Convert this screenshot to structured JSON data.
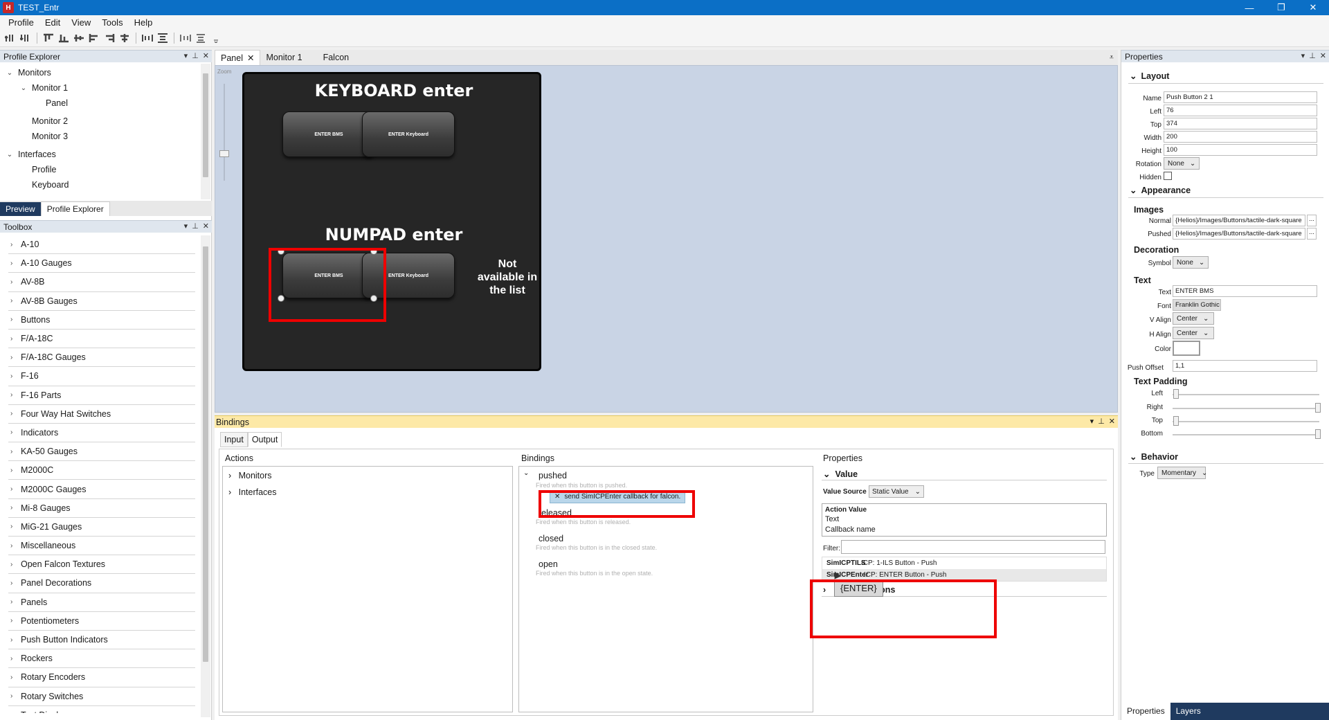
{
  "window": {
    "title": "TEST_Entr",
    "minimize": "—",
    "restore": "❐",
    "close": "✕"
  },
  "menu": [
    "Profile",
    "Edit",
    "View",
    "Tools",
    "Help"
  ],
  "profile_explorer": {
    "title": "Profile Explorer",
    "tree": [
      {
        "label": "Monitors",
        "level": 0,
        "expanded": true
      },
      {
        "label": "Monitor 1",
        "level": 1,
        "expanded": true
      },
      {
        "label": "Panel",
        "level": 2
      },
      {
        "label": "Monitor 2",
        "level": 1
      },
      {
        "label": "Monitor 3",
        "level": 1
      },
      {
        "label": "Interfaces",
        "level": 0,
        "expanded": true
      },
      {
        "label": "Profile",
        "level": 1
      },
      {
        "label": "Keyboard",
        "level": 1
      }
    ],
    "tabs": [
      "Preview",
      "Profile Explorer"
    ]
  },
  "toolbox": {
    "title": "Toolbox",
    "items": [
      "A-10",
      "A-10 Gauges",
      "AV-8B",
      "AV-8B Gauges",
      "Buttons",
      "F/A-18C",
      "F/A-18C Gauges",
      "F-16",
      "F-16 Parts",
      "Four Way Hat Switches",
      "Indicators",
      "KA-50 Gauges",
      "M2000C",
      "M2000C Gauges",
      "Mi-8 Gauges",
      "MiG-21 Gauges",
      "Miscellaneous",
      "Open Falcon Textures",
      "Panel Decorations",
      "Panels",
      "Potentiometers",
      "Push Button Indicators",
      "Rockers",
      "Rotary Encoders",
      "Rotary Switches",
      "Text Displays"
    ]
  },
  "doc_tabs": [
    "Panel",
    "Monitor 1",
    "Falcon"
  ],
  "canvas": {
    "zoom_label": "Zoom",
    "keyboard_heading": "KEYBOARD enter",
    "numpad_heading": "NUMPAD enter",
    "btn_bms": "ENTER BMS",
    "btn_keyboard": "ENTER Keyboard",
    "note": "Not available in the list"
  },
  "bindings": {
    "title": "Bindings",
    "tabs": [
      "Input",
      "Output"
    ],
    "actions_title": "Actions",
    "actions": [
      "Monitors",
      "Interfaces"
    ],
    "bindings_title": "Bindings",
    "events": [
      {
        "name": "pushed",
        "desc": "Fired when this button is pushed."
      },
      {
        "name": "released",
        "desc": "Fired when this button is released."
      },
      {
        "name": "closed",
        "desc": "Fired when this button is in the closed state."
      },
      {
        "name": "open",
        "desc": "Fired when this button is in the open state."
      }
    ],
    "chip": "send SimICPEnter callback for falcon.",
    "properties_title": "Properties",
    "value_section": "Value",
    "value_source_label": "Value Source",
    "value_source": "Static Value",
    "action_value_title": "Action Value",
    "action_value_text": "Text",
    "action_value_callback": "Callback name",
    "filter_label": "Filter:",
    "callbacks": [
      {
        "name": "SimICPTILS",
        "desc": "ICP: 1-ILS Button - Push"
      },
      {
        "name": "SimICPEnter",
        "desc": "ICP: ENTER Button - Push"
      }
    ],
    "options_suffix": "ons",
    "tooltip": "{ENTER}"
  },
  "properties": {
    "title": "Properties",
    "layout": "Layout",
    "name_label": "Name",
    "name": "Push Button 2 1",
    "left_label": "Left",
    "left": "76",
    "top_label": "Top",
    "top": "374",
    "width_label": "Width",
    "width": "200",
    "height_label": "Height",
    "height": "100",
    "rotation_label": "Rotation",
    "rotation": "None",
    "hidden_label": "Hidden",
    "appearance": "Appearance",
    "images": "Images",
    "normal_label": "Normal",
    "normal": "{Helios}/Images/Buttons/tactile-dark-square",
    "pushed_label": "Pushed",
    "pushed": "{Helios}/Images/Buttons/tactile-dark-square",
    "browse": "...",
    "decoration": "Decoration",
    "symbol_label": "Symbol",
    "symbol": "None",
    "text_section": "Text",
    "text_label": "Text",
    "text": "ENTER BMS",
    "font_label": "Font",
    "font": "Franklin Gothic",
    "valign_label": "V Align",
    "valign": "Center",
    "halign_label": "H Align",
    "halign": "Center",
    "color_label": "Color",
    "push_offset_label": "Push Offset",
    "push_offset": "1,1",
    "text_padding": "Text Padding",
    "pad_left_label": "Left",
    "pad_right_label": "Right",
    "pad_top_label": "Top",
    "pad_bottom_label": "Bottom",
    "behavior": "Behavior",
    "type_label": "Type",
    "type": "Momentary",
    "tabs": [
      "Properties",
      "Layers"
    ]
  }
}
